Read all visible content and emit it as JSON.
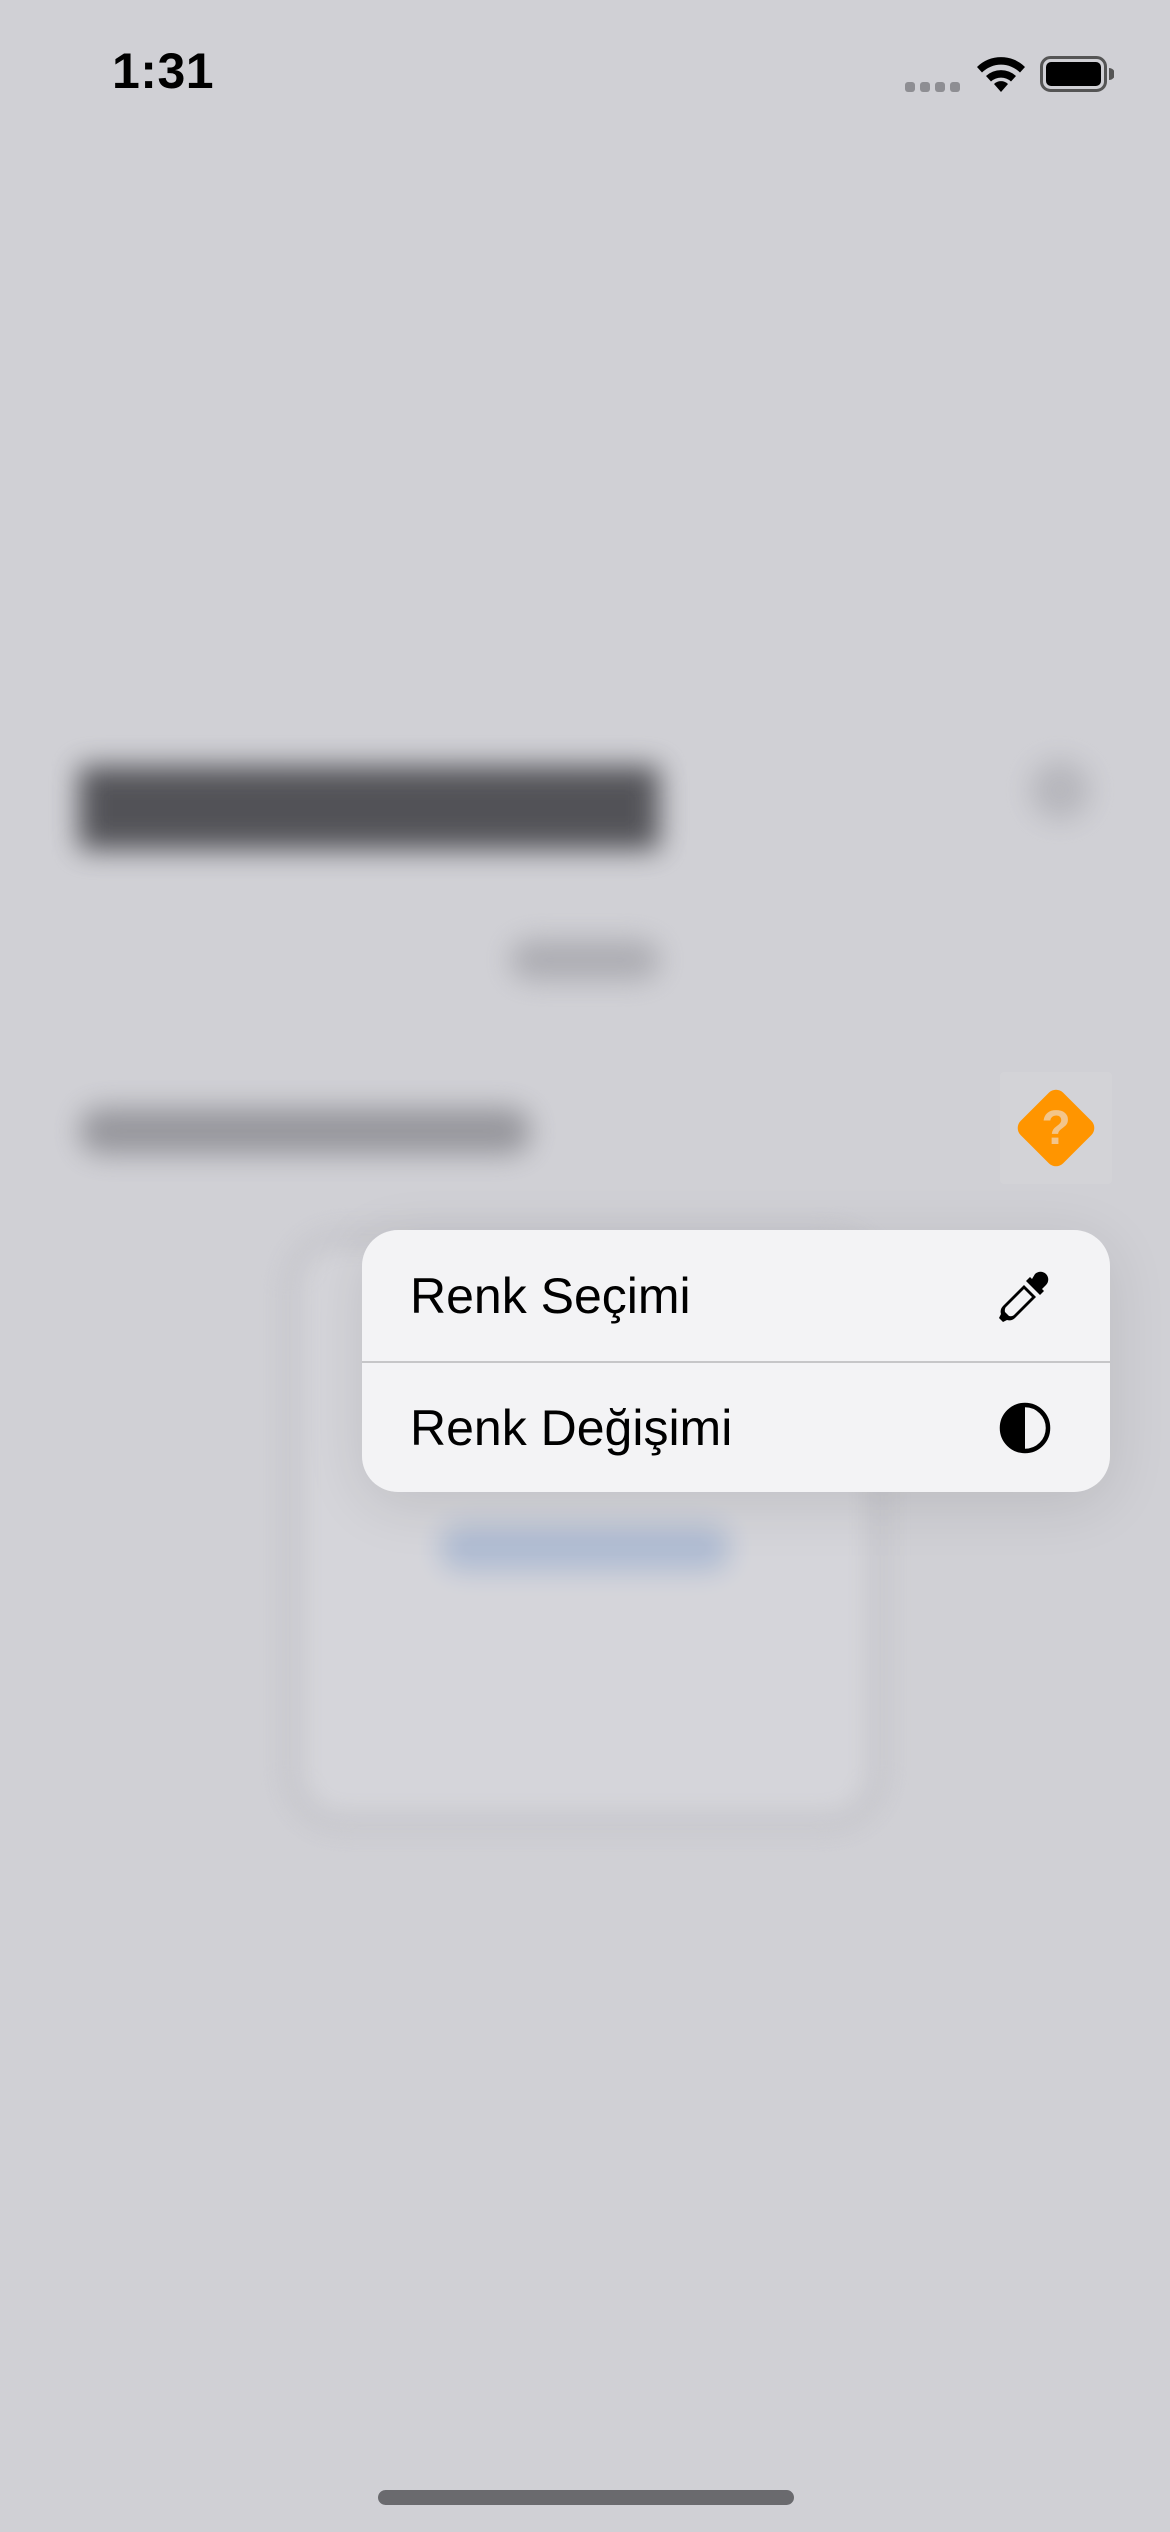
{
  "status_bar": {
    "time": "1:31"
  },
  "context_menu": {
    "items": [
      {
        "label": "Renk Seçimi",
        "icon": "eyedropper-icon"
      },
      {
        "label": "Renk Değişimi",
        "icon": "contrast-circle-icon"
      }
    ]
  },
  "source_item": {
    "icon": "warning-question-diamond-icon",
    "glyph": "?",
    "color": "#ff9500"
  },
  "colors": {
    "dimmed_background": "#d0d0d5",
    "menu_background": "#f4f4f6",
    "accent_orange": "#ff9500"
  }
}
